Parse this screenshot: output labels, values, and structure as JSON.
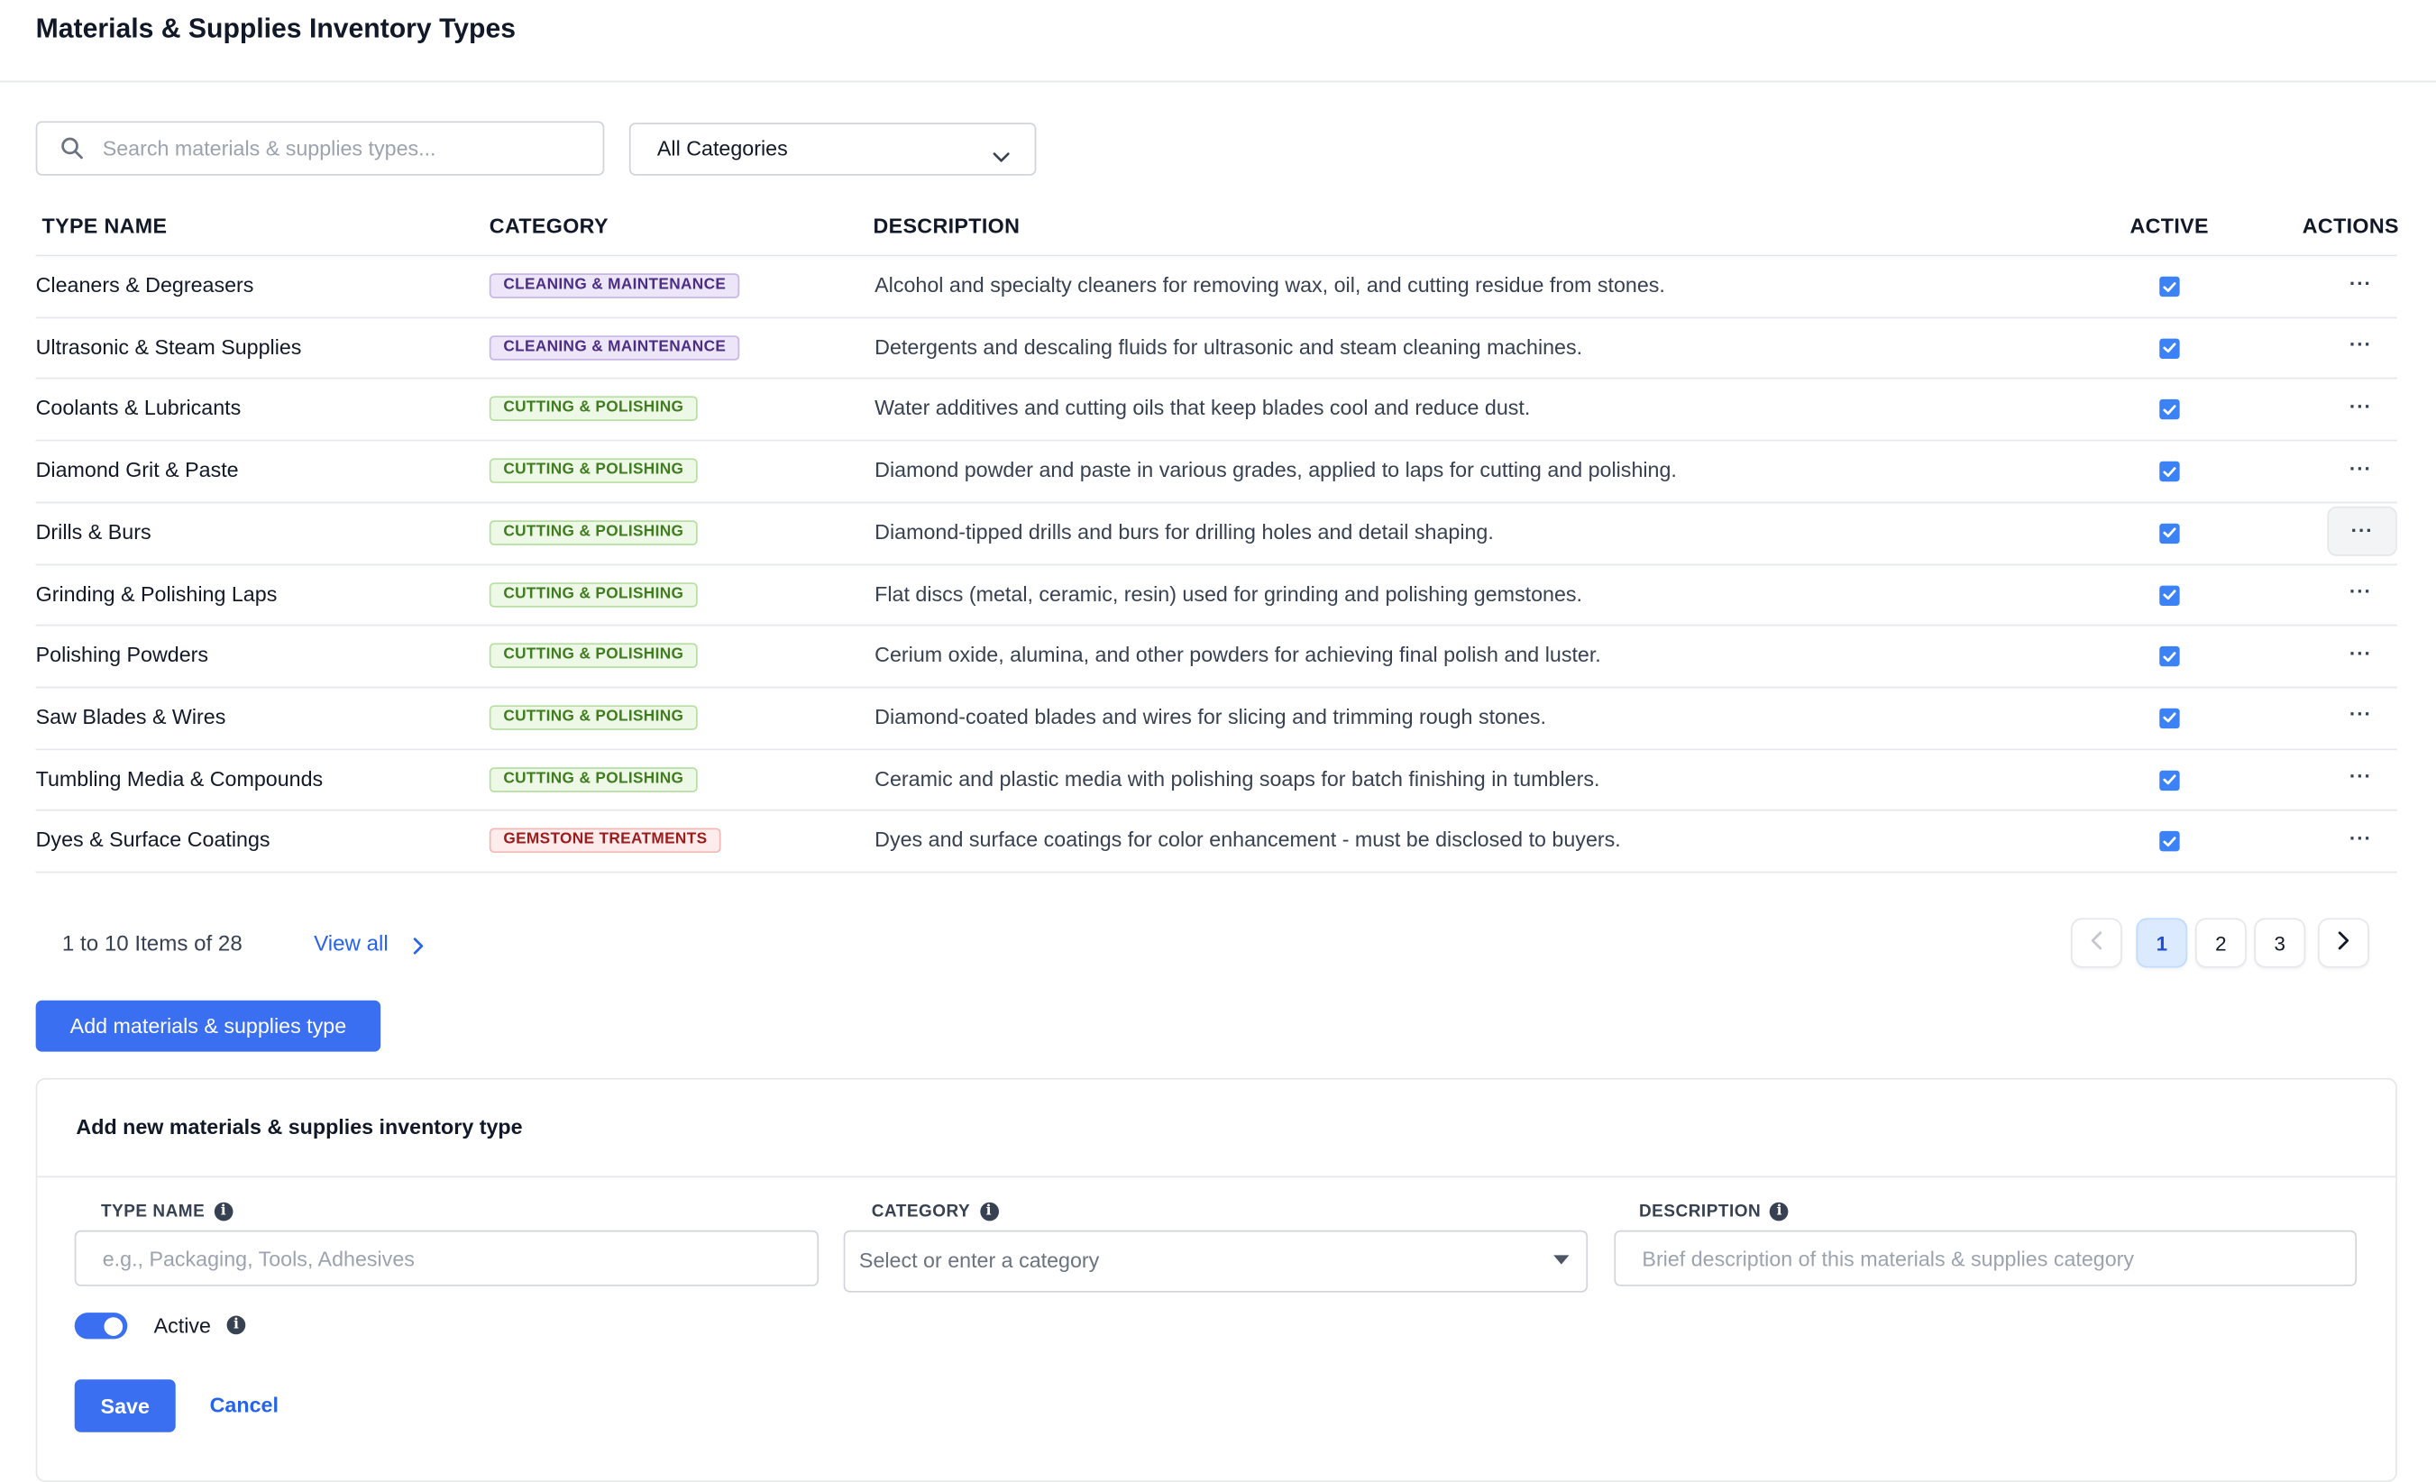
{
  "page": {
    "title": "Materials & Supplies Inventory Types"
  },
  "filters": {
    "search_placeholder": "Search materials & supplies types...",
    "category_selected": "All Categories"
  },
  "table": {
    "columns": {
      "type_name": "TYPE NAME",
      "category": "CATEGORY",
      "description": "DESCRIPTION",
      "active": "ACTIVE",
      "actions": "ACTIONS"
    },
    "rows": [
      {
        "name": "Cleaners & Degreasers",
        "category": "CLEANING & MAINTENANCE",
        "category_color": "purple",
        "description": "Alcohol and specialty cleaners for removing wax, oil, and cutting residue from stones.",
        "active": true
      },
      {
        "name": "Ultrasonic & Steam Supplies",
        "category": "CLEANING & MAINTENANCE",
        "category_color": "purple",
        "description": "Detergents and descaling fluids for ultrasonic and steam cleaning machines.",
        "active": true
      },
      {
        "name": "Coolants & Lubricants",
        "category": "CUTTING & POLISHING",
        "category_color": "green",
        "description": "Water additives and cutting oils that keep blades cool and reduce dust.",
        "active": true
      },
      {
        "name": "Diamond Grit & Paste",
        "category": "CUTTING & POLISHING",
        "category_color": "green",
        "description": "Diamond powder and paste in various grades, applied to laps for cutting and polishing.",
        "active": true
      },
      {
        "name": "Drills & Burs",
        "category": "CUTTING & POLISHING",
        "category_color": "green",
        "description": "Diamond-tipped drills and burs for drilling holes and detail shaping.",
        "active": true,
        "actions_hover": true
      },
      {
        "name": "Grinding & Polishing Laps",
        "category": "CUTTING & POLISHING",
        "category_color": "green",
        "description": "Flat discs (metal, ceramic, resin) used for grinding and polishing gemstones.",
        "active": true
      },
      {
        "name": "Polishing Powders",
        "category": "CUTTING & POLISHING",
        "category_color": "green",
        "description": "Cerium oxide, alumina, and other powders for achieving final polish and luster.",
        "active": true
      },
      {
        "name": "Saw Blades & Wires",
        "category": "CUTTING & POLISHING",
        "category_color": "green",
        "description": "Diamond-coated blades and wires for slicing and trimming rough stones.",
        "active": true
      },
      {
        "name": "Tumbling Media & Compounds",
        "category": "CUTTING & POLISHING",
        "category_color": "green",
        "description": "Ceramic and plastic media with polishing soaps for batch finishing in tumblers.",
        "active": true
      },
      {
        "name": "Dyes & Surface Coatings",
        "category": "GEMSTONE TREATMENTS",
        "category_color": "red",
        "description": "Dyes and surface coatings for color enhancement - must be disclosed to buyers.",
        "active": true
      }
    ],
    "row_actions_label": "···"
  },
  "pagination": {
    "summary": "1 to 10 Items of 28",
    "view_all": "View all",
    "pages": [
      "1",
      "2",
      "3"
    ],
    "current_page": "1"
  },
  "add_button_label": "Add materials & supplies type",
  "form": {
    "title": "Add new materials & supplies inventory type",
    "type_name_label": "TYPE NAME",
    "type_name_placeholder": "e.g., Packaging, Tools, Adhesives",
    "category_label": "CATEGORY",
    "category_placeholder": "Select or enter a category",
    "description_label": "DESCRIPTION",
    "description_placeholder": "Brief description of this materials & supplies category",
    "active_label": "Active",
    "active_value": true,
    "save_label": "Save",
    "cancel_label": "Cancel"
  },
  "colors": {
    "primary": "#3b6ff2",
    "link": "#2563eb",
    "checkbox": "#3b82f6"
  },
  "icons": {
    "info": "i"
  }
}
